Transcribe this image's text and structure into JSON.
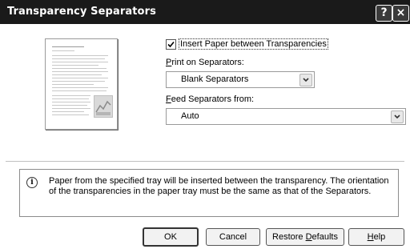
{
  "window": {
    "title": "Transparency Separators",
    "help_button": "?",
    "close_button": "×"
  },
  "options": {
    "insert_paper_label": "Insert Paper between Transparencies",
    "insert_paper_checked": true,
    "print_on_label_first": "P",
    "print_on_label_rest": "rint on Separators:",
    "print_on_value": "Blank Separators",
    "feed_from_label_first": "F",
    "feed_from_label_rest": "eed Separators from:",
    "feed_from_value": "Auto"
  },
  "info": {
    "icon_glyph": "i",
    "text": "Paper from the specified tray will be inserted between the transparency. The orientation of the transparencies in the paper tray must be the same as that of the Separators."
  },
  "buttons": {
    "ok": "OK",
    "cancel": "Cancel",
    "restore_first": "Restore ",
    "restore_underlined": "D",
    "restore_rest": "efaults",
    "help_first": "H",
    "help_rest": "elp"
  }
}
